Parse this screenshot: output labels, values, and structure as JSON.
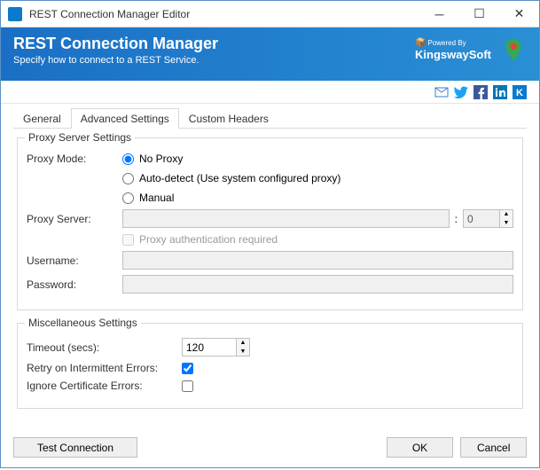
{
  "window": {
    "title": "REST Connection Manager Editor"
  },
  "banner": {
    "title": "REST Connection Manager",
    "subtitle": "Specify how to connect to a REST Service.",
    "powered_top": "Powered By",
    "powered_name": "KingswaySoft"
  },
  "tabs": {
    "items": [
      {
        "label": "General",
        "active": false
      },
      {
        "label": "Advanced Settings",
        "active": true
      },
      {
        "label": "Custom Headers",
        "active": false
      }
    ]
  },
  "proxy": {
    "legend": "Proxy Server Settings",
    "mode_label": "Proxy Mode:",
    "options": {
      "no_proxy": "No Proxy",
      "auto": "Auto-detect (Use system configured proxy)",
      "manual": "Manual"
    },
    "server_label": "Proxy Server:",
    "server_value": "",
    "port_value": "0",
    "auth_required_label": "Proxy authentication required",
    "username_label": "Username:",
    "username_value": "",
    "password_label": "Password:",
    "password_value": ""
  },
  "misc": {
    "legend": "Miscellaneous Settings",
    "timeout_label": "Timeout (secs):",
    "timeout_value": "120",
    "retry_label": "Retry on Intermittent Errors:",
    "ignore_cert_label": "Ignore Certificate Errors:"
  },
  "footer": {
    "test": "Test Connection",
    "ok": "OK",
    "cancel": "Cancel"
  }
}
